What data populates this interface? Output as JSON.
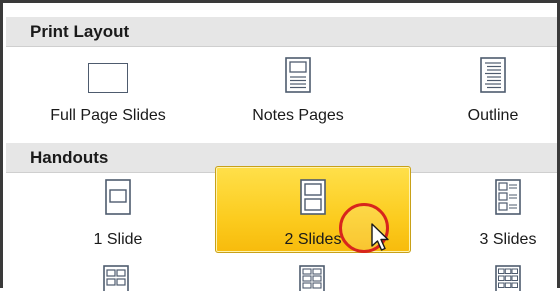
{
  "sections": {
    "print_layout": "Print Layout",
    "handouts": "Handouts"
  },
  "print_layout_items": [
    {
      "label": "Full Page Slides",
      "icon": "full-page-slide-icon"
    },
    {
      "label": "Notes Pages",
      "icon": "notes-page-icon"
    },
    {
      "label": "Outline",
      "icon": "outline-icon"
    }
  ],
  "handout_items": [
    {
      "label": "1 Slide",
      "icon": "one-slide-icon"
    },
    {
      "label": "2 Slides",
      "icon": "two-slides-icon",
      "selected": true
    },
    {
      "label": "3 Slides",
      "icon": "three-slides-icon"
    }
  ],
  "colors": {
    "selected_fill": "#fccc1f",
    "header_bg": "#e6e6e6",
    "highlight_circle": "#d8251c"
  }
}
